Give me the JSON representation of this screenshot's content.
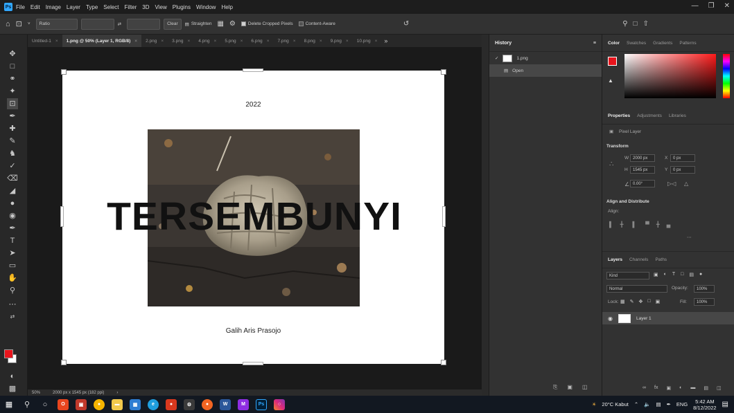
{
  "menubar": {
    "app_icon": "Ps",
    "items": [
      "File",
      "Edit",
      "Image",
      "Layer",
      "Type",
      "Select",
      "Filter",
      "3D",
      "View",
      "Plugins",
      "Window",
      "Help"
    ],
    "window_controls": [
      "minimize-icon",
      "restore-icon",
      "close-icon"
    ]
  },
  "options": {
    "ratio": "Ratio",
    "clear": "Clear",
    "straighten": "Straighten",
    "delete_cropped": "Delete Cropped Pixels",
    "delete_cropped_checked": true,
    "content_aware": "Content-Aware",
    "content_aware_checked": false
  },
  "tabs": [
    {
      "label": "Untitled-1",
      "active": false
    },
    {
      "label": "1.png @ 50% (Layer 1, RGB/8)",
      "active": true
    },
    {
      "label": "2.png",
      "active": false
    },
    {
      "label": "3.png",
      "active": false
    },
    {
      "label": "4.png",
      "active": false
    },
    {
      "label": "5.png",
      "active": false
    },
    {
      "label": "6.png",
      "active": false
    },
    {
      "label": "7.png",
      "active": false
    },
    {
      "label": "8.png",
      "active": false
    },
    {
      "label": "9.png",
      "active": false
    },
    {
      "label": "10.png",
      "active": false
    }
  ],
  "document": {
    "year": "2022",
    "title": "TERSEMBUNYI",
    "author": "Galih Aris Prasojo"
  },
  "status": {
    "zoom": "50%",
    "dimensions": "2000 px x 1545 px (182 ppi)"
  },
  "history": {
    "title": "History",
    "snapshot": "1.png",
    "steps": [
      "Open"
    ]
  },
  "color_panel": {
    "tabs": [
      "Color",
      "Swatches",
      "Gradients",
      "Patterns"
    ],
    "foreground": "#e8141c"
  },
  "properties": {
    "tabs": [
      "Properties",
      "Adjustments",
      "Libraries"
    ],
    "kind": "Pixel Layer",
    "transform_label": "Transform",
    "w": "2000 px",
    "h": "1545 px",
    "x": "0 px",
    "y": "0 px",
    "angle": "0.00°",
    "align_label": "Align and Distribute",
    "align_sub": "Align:"
  },
  "layers": {
    "tabs": [
      "Layers",
      "Channels",
      "Paths"
    ],
    "filter": "Kind",
    "blend": "Normal",
    "opacity_label": "Opacity:",
    "opacity": "100%",
    "lock_label": "Lock:",
    "fill_label": "Fill:",
    "fill": "100%",
    "items": [
      "Layer 1"
    ]
  },
  "taskbar": {
    "weather": "20°C Kabut",
    "lang": "ENG",
    "time": "5:42 AM",
    "date": "8/12/2022"
  }
}
